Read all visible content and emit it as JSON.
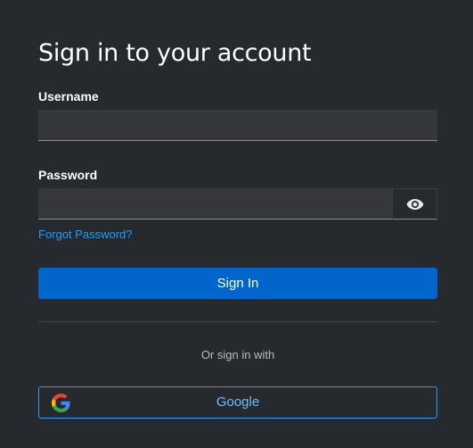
{
  "title": "Sign in to your account",
  "username": {
    "label": "Username",
    "value": "",
    "placeholder": ""
  },
  "password": {
    "label": "Password",
    "value": "",
    "placeholder": "",
    "toggle_icon": "eye-icon"
  },
  "forgot_password": "Forgot Password?",
  "sign_in_label": "Sign In",
  "or_text": "Or sign in with",
  "providers": [
    {
      "label": "Google",
      "icon": "google-icon"
    }
  ],
  "colors": {
    "background": "#26292d",
    "input_background": "#36373a",
    "primary": "#0066cc",
    "link": "#2b9af3",
    "provider_text": "#73bcf7"
  }
}
